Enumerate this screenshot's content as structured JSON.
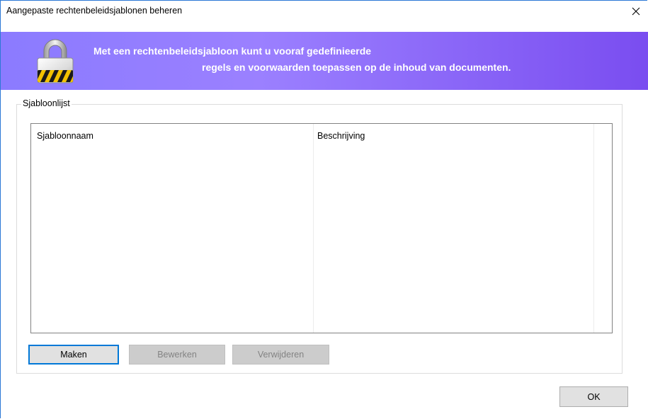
{
  "window": {
    "title": "Aangepaste rechtenbeleidsjablonen beheren"
  },
  "banner": {
    "line1": "Met een rechtenbeleidsjabloon kunt u vooraf gedefinieerde",
    "line2": "regels en voorwaarden toepassen op de inhoud van documenten.",
    "icon": "padlock-icon",
    "colors": {
      "start": "#8b7bff",
      "end": "#7a4df0"
    }
  },
  "template_list": {
    "group_label": "Sjabloonlijst",
    "columns": [
      "Sjabloonnaam",
      "Beschrijving"
    ],
    "rows": []
  },
  "actions": {
    "create_label": "Maken",
    "edit_label": "Bewerken",
    "delete_label": "Verwijderen",
    "ok_label": "OK"
  },
  "colors": {
    "focus_border": "#0078d7",
    "disabled_text": "#838383"
  }
}
